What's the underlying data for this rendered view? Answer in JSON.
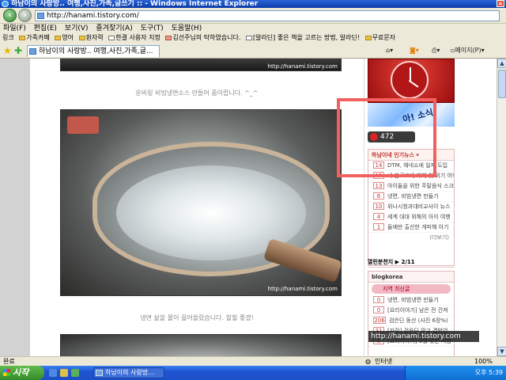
{
  "window": {
    "title": "하남이의 사랑방.. 여행,사진,가족,글쓰기 :: - Windows Internet Explorer"
  },
  "address": {
    "url": "http://hanami.tistory.com/"
  },
  "menu": {
    "items": [
      "파일(F)",
      "편집(E)",
      "보기(V)",
      "즐겨찾기(A)",
      "도구(T)",
      "도움말(H)"
    ]
  },
  "favorites": {
    "label": "링크",
    "items": [
      "가족카페",
      "영어",
      "환자력",
      "한결 사용자 지정",
      "김선주님의 탁하였습니다.",
      "[알라딘] 좋은 책을 고르는 방법, 알라딘!",
      "무료문자"
    ]
  },
  "tab": {
    "label": "하남이의 사랑방.. 여행,사진,가족,글..."
  },
  "toolbar": {
    "page_label": "페이지(P)"
  },
  "post": {
    "caption1": "운비링 비빔냉면소스 만들어 줌이랍니다. ^_^",
    "caption2": "냉면 삶을 물이 끓어올랐습니다. 헐헐 좋겠!",
    "watermark": "http://hanami.tistory.com"
  },
  "sidebar": {
    "banner_text": "아! 소식",
    "visitor_count": "472",
    "news": {
      "title": "하남이네 인기뉴스",
      "items": [
        {
          "num": "14",
          "text": "DTM, 헤네쇼에 일제 도입"
        },
        {
          "num": "12",
          "text": "내 블로그에 매체 첫 위기 어디"
        },
        {
          "num": "13",
          "text": "아이들을 위한 주말음식 스크레"
        },
        {
          "num": "6",
          "text": "냉면, 비빔냉면 만들기"
        },
        {
          "num": "10",
          "text": "위나시청과대비교사이 뉴스"
        },
        {
          "num": "4",
          "text": "세계 대대 위해의 아이 여행"
        },
        {
          "num": "1",
          "text": "들에만 출산한 개피해 아기"
        }
      ],
      "more": "(더보기)"
    },
    "fans": "열린분천지 ▶ 2/11",
    "blogkorea": {
      "title": "blogkorea",
      "highlight": "지역 최신글",
      "items": [
        {
          "num": "0",
          "text": "냉면, 비빔냉면 만들기"
        },
        {
          "num": "0",
          "text": "[요리이야기] 남은 전 건져"
        },
        {
          "num": "206",
          "text": "검은딘 동산 (사진 6장%)"
        },
        {
          "num": "31",
          "text": "[자장] 검은딘 맞고 겹받았"
        },
        {
          "num": "0",
          "text": "[요리이야기] 5월 맞은 사람"
        }
      ]
    }
  },
  "overlay": {
    "url_bubble": "http://hanami.tistory.com"
  },
  "statusbar": {
    "left": "완료",
    "zone": "인터넷",
    "zoom": "100%"
  },
  "taskbar": {
    "start": "시작",
    "task": "하남이의 사랑방...",
    "clock": "오후 5:39"
  },
  "colors": {
    "title_blue": "#0a3ba8",
    "highlight_red": "#f26060",
    "taskbar_blue": "#1f55d2",
    "start_green": "#358a2a"
  }
}
